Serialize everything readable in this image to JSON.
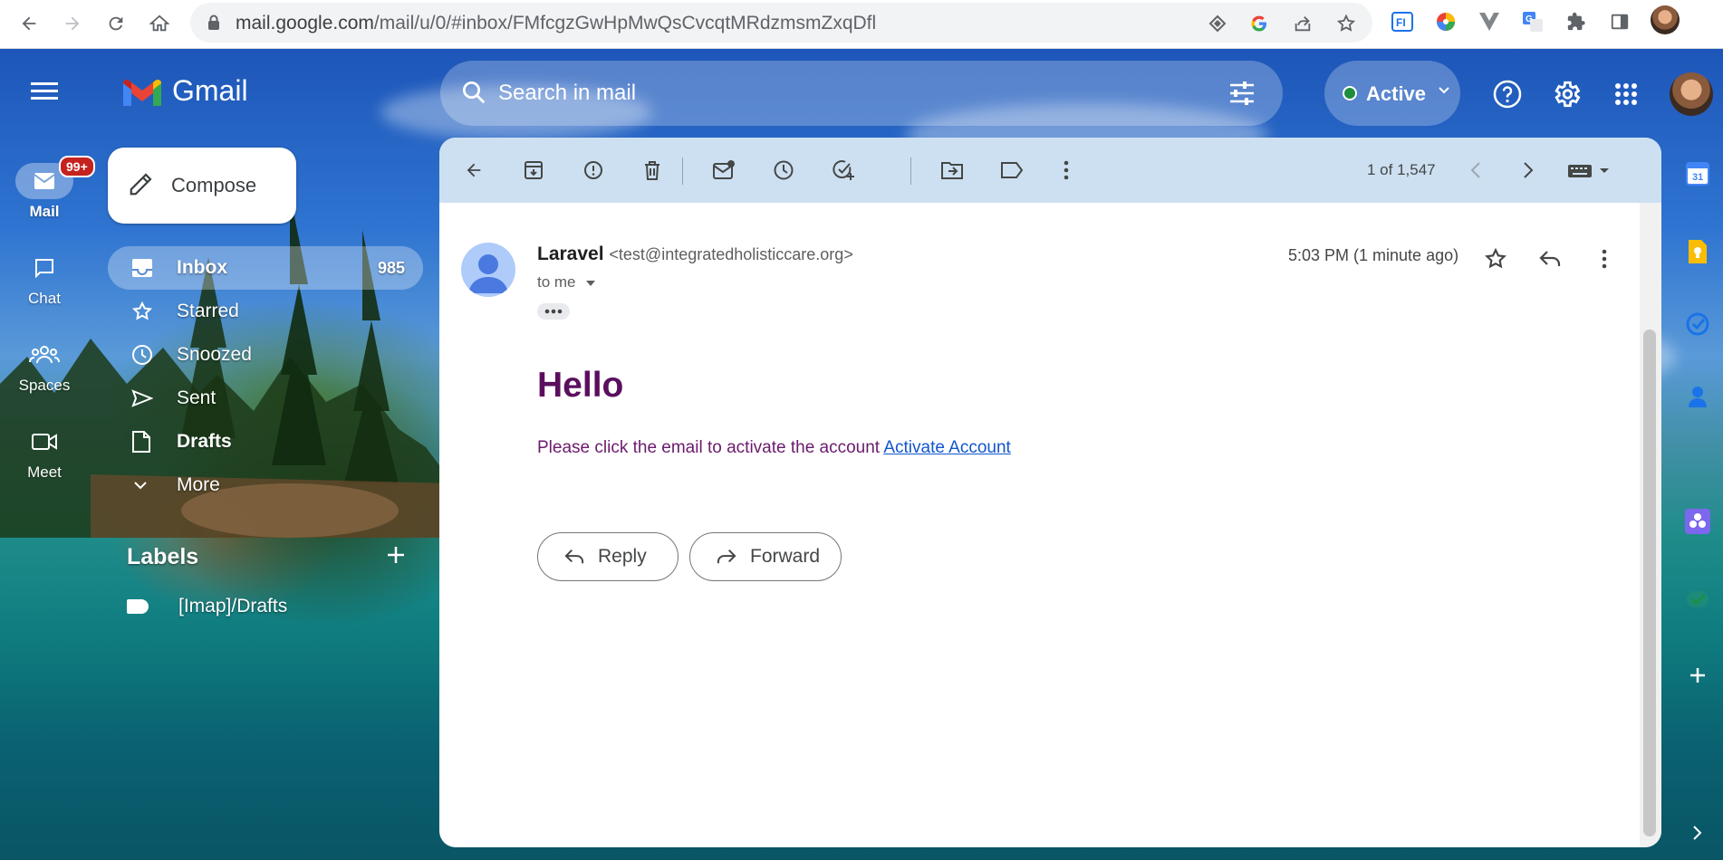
{
  "browser": {
    "url_host": "mail.google.com",
    "url_path": "/mail/u/0/#inbox/FMfcgzGwHpMwQsCvcqtMRdzmsmZxqDfl"
  },
  "app": {
    "name": "Gmail"
  },
  "rail": {
    "items": [
      {
        "label": "Mail",
        "badge": "99+"
      },
      {
        "label": "Chat"
      },
      {
        "label": "Spaces"
      },
      {
        "label": "Meet"
      }
    ]
  },
  "search": {
    "placeholder": "Search in mail"
  },
  "status": {
    "label": "Active",
    "color": "#1e8e3e"
  },
  "compose": {
    "label": "Compose"
  },
  "nav": {
    "items": [
      {
        "label": "Inbox",
        "count": "985",
        "icon": "inbox-icon"
      },
      {
        "label": "Starred",
        "icon": "star-icon"
      },
      {
        "label": "Snoozed",
        "icon": "clock-icon"
      },
      {
        "label": "Sent",
        "icon": "send-icon"
      },
      {
        "label": "Drafts",
        "icon": "file-icon"
      },
      {
        "label": "More",
        "icon": "chevron-down-icon"
      }
    ]
  },
  "labels": {
    "title": "Labels",
    "items": [
      {
        "label": "[Imap]/Drafts"
      }
    ]
  },
  "toolbar": {
    "pager": "1 of 1,547"
  },
  "message": {
    "sender_name": "Laravel",
    "sender_email": "<test@integratedholisticcare.org>",
    "recipient": "to me",
    "time": "5:03 PM (1 minute ago)",
    "heading": "Hello",
    "body": "Please click the email to activate the account ",
    "link_text": "Activate Account",
    "heading_color": "#5b0e5e",
    "link_color": "#1155cc"
  },
  "actions": {
    "reply": "Reply",
    "forward": "Forward"
  }
}
